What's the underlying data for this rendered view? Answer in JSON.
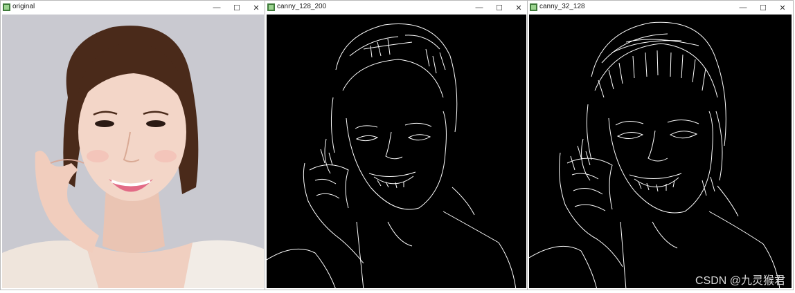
{
  "windows": [
    {
      "title": "original",
      "minimize": "—",
      "maximize": "☐",
      "close": "✕"
    },
    {
      "title": "canny_128_200",
      "minimize": "—",
      "maximize": "☐",
      "close": "✕"
    },
    {
      "title": "canny_32_128",
      "minimize": "—",
      "maximize": "☐",
      "close": "✕"
    }
  ],
  "watermark": "CSDN @九灵猴君",
  "colors": {
    "canvas_black": "#000000",
    "edge_white": "#ffffff",
    "bg_original": "#c9c9d0",
    "hair": "#4a2a1a",
    "skin": "#f3d6c8"
  }
}
